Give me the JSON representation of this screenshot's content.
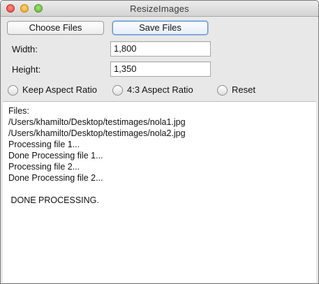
{
  "window": {
    "title": "ResizeImages"
  },
  "toolbar": {
    "choose_files_label": "Choose Files",
    "save_files_label": "Save Files"
  },
  "form": {
    "width_label": "Width:",
    "width_value": "1,800",
    "height_label": "Height:",
    "height_value": "1,350"
  },
  "options": {
    "keep_aspect_label": "Keep Aspect Ratio",
    "four_three_label": "4:3 Aspect Ratio",
    "reset_label": "Reset"
  },
  "log": {
    "lines": [
      "Files:",
      "/Users/khamilto/Desktop/testimages/nola1.jpg",
      "/Users/khamilto/Desktop/testimages/nola2.jpg",
      "Processing file 1...",
      "Done Processing file 1...",
      "Processing file 2...",
      "Done Processing file 2...",
      "",
      " DONE PROCESSING."
    ]
  },
  "colors": {
    "window_bg": "#e8e8e8",
    "default_button_border": "#5e8ecb",
    "close": "#e0443e",
    "minimize": "#dea123",
    "zoom": "#5fb13a"
  }
}
